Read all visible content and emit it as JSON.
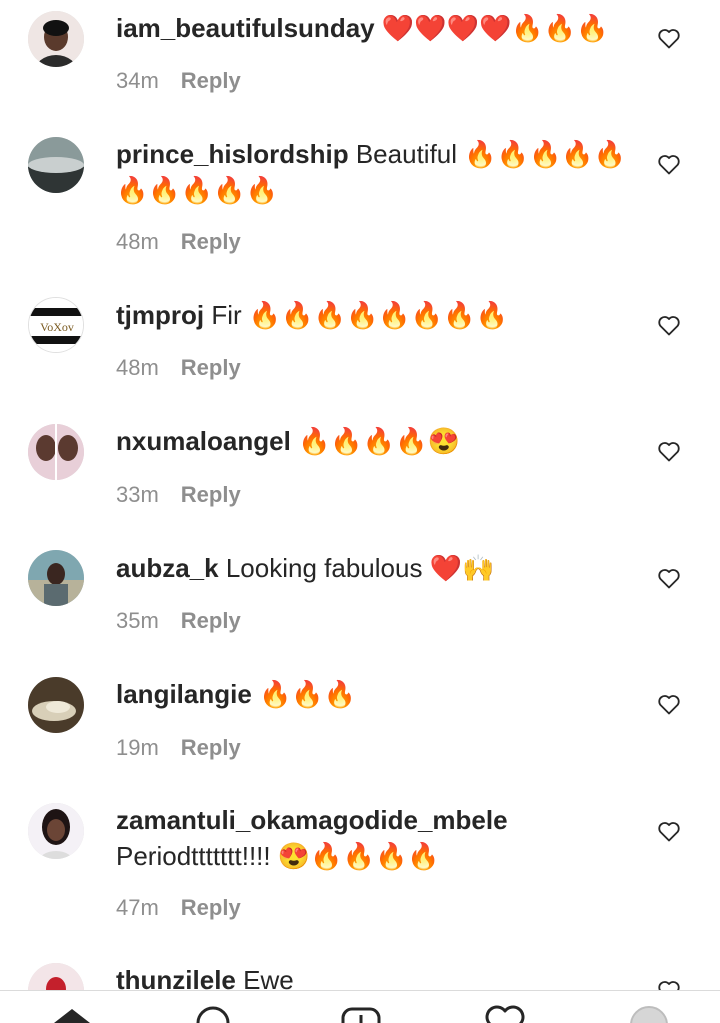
{
  "comments": [
    {
      "username": "iam_beautifulsunday",
      "text": "❤️❤️❤️❤️🔥🔥🔥",
      "time": "34m",
      "reply": "Reply"
    },
    {
      "username": "prince_hislordship",
      "text": "Beautiful 🔥🔥🔥🔥🔥🔥🔥🔥🔥🔥",
      "time": "48m",
      "reply": "Reply"
    },
    {
      "username": "tjmproj",
      "text": "Fir 🔥🔥🔥🔥🔥🔥🔥🔥",
      "time": "48m",
      "reply": "Reply"
    },
    {
      "username": "nxumaloangel",
      "text": "🔥🔥🔥🔥😍",
      "time": "33m",
      "reply": "Reply"
    },
    {
      "username": "aubza_k",
      "text": "Looking fabulous ❤️🙌",
      "time": "35m",
      "reply": "Reply"
    },
    {
      "username": "langilangie",
      "text": "🔥🔥🔥",
      "time": "19m",
      "reply": "Reply"
    },
    {
      "username": "zamantuli_okamagodide_mbele",
      "text": "Periodttttttt!!!! 😍🔥🔥🔥🔥",
      "time": "47m",
      "reply": "Reply"
    },
    {
      "username": "thunzilele",
      "text": "Ewe",
      "time": "",
      "reply": ""
    }
  ],
  "avatar_logo_text": "VoXov",
  "colors": {
    "text": "#262626",
    "secondary": "#8e8e8e",
    "divider": "#dbdbdb"
  },
  "nav_icons": [
    "home-icon",
    "search-icon",
    "add-post-icon",
    "activity-heart-icon",
    "profile-avatar"
  ]
}
